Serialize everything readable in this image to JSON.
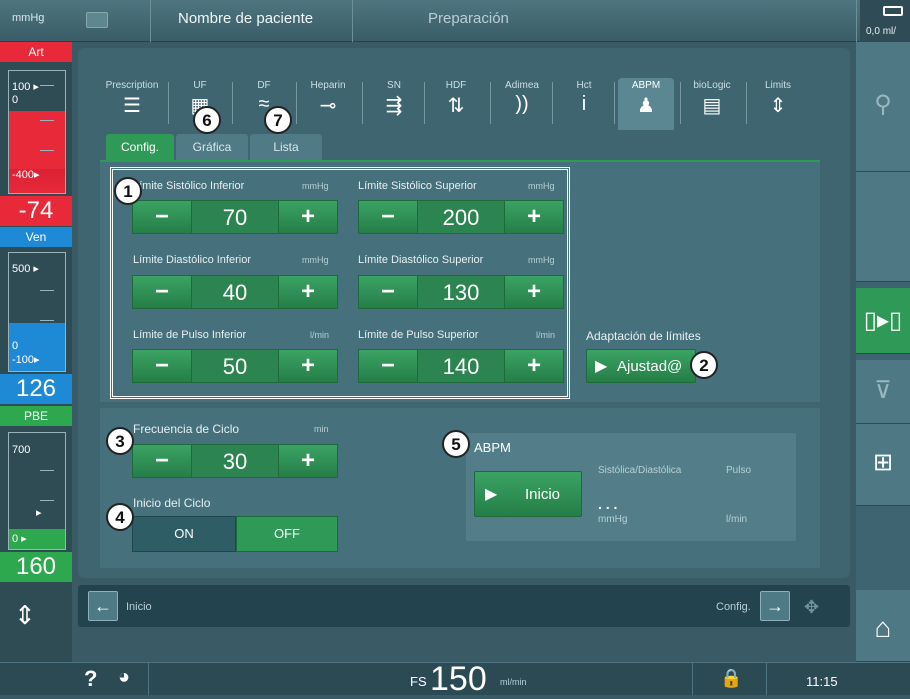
{
  "header": {
    "unit": "mmHg",
    "patient_name": "Nombre de paciente",
    "phase": "Preparación",
    "right_value": "0,0",
    "right_unit": "ml/"
  },
  "left": {
    "art": {
      "label": "Art",
      "max": "100",
      "min_top": "0",
      "min": "-400",
      "value": "-74",
      "color": "#e8293a"
    },
    "ven": {
      "label": "Ven",
      "max": "500",
      "min_top": "0",
      "min": "-100",
      "value": "126",
      "color": "#1e8ad6"
    },
    "pbe": {
      "label": "PBE",
      "max": "700",
      "min": "0",
      "value": "160",
      "color": "#2ea84f"
    }
  },
  "tabs": [
    {
      "label": "Prescription",
      "icon": "sliders-icon",
      "glyph": "☰"
    },
    {
      "label": "UF",
      "icon": "uf-icon",
      "glyph": "▦"
    },
    {
      "label": "DF",
      "icon": "df-icon",
      "glyph": "≈"
    },
    {
      "label": "Heparin",
      "icon": "syringe-icon",
      "glyph": "⊸"
    },
    {
      "label": "SN",
      "icon": "single-needle-icon",
      "glyph": "⇶"
    },
    {
      "label": "HDF",
      "icon": "hdf-icon",
      "glyph": "⇅"
    },
    {
      "label": "Adimea",
      "icon": "signal-icon",
      "glyph": "))"
    },
    {
      "label": "Hct",
      "icon": "hct-icon",
      "glyph": "i"
    },
    {
      "label": "ABPM",
      "icon": "person-icon",
      "glyph": "♟"
    },
    {
      "label": "bioLogic",
      "icon": "biologic-icon",
      "glyph": "▤"
    },
    {
      "label": "Limits",
      "icon": "limits-icon",
      "glyph": "⇕"
    }
  ],
  "subtabs": {
    "config": "Config.",
    "grafica": "Gráfica",
    "lista": "Lista"
  },
  "limits": {
    "sys_low": {
      "label": "Límite Sistólico Inferior",
      "unit": "mmHg",
      "value": "70"
    },
    "sys_high": {
      "label": "Límite Sistólico Superior",
      "unit": "mmHg",
      "value": "200"
    },
    "dia_low": {
      "label": "Límite Diastólico Inferior",
      "unit": "mmHg",
      "value": "40"
    },
    "dia_high": {
      "label": "Límite Diastólico Superior",
      "unit": "mmHg",
      "value": "130"
    },
    "pulse_low": {
      "label": "Límite de Pulso Inferior",
      "unit": "l/min",
      "value": "50"
    },
    "pulse_high": {
      "label": "Límite de Pulso Superior",
      "unit": "l/min",
      "value": "140"
    }
  },
  "stepper": {
    "minus": "−",
    "plus": "+"
  },
  "adaptation": {
    "label": "Adaptación de límites",
    "button": "Ajustad@"
  },
  "cycle": {
    "label": "Frecuencia de Ciclo",
    "unit": "min",
    "value": "30"
  },
  "start": {
    "label": "Inicio del Ciclo",
    "on": "ON",
    "off": "OFF"
  },
  "abpm": {
    "title": "ABPM",
    "button": "Inicio",
    "sys_dia": "Sistólica/Diastólica",
    "pulse": "Pulso",
    "value": ". . .",
    "unit1": "mmHg",
    "unit2": "l/min"
  },
  "callouts": [
    "1",
    "2",
    "3",
    "4",
    "5",
    "6",
    "7"
  ],
  "nav": {
    "back_label": "Inicio",
    "next_label": "Config."
  },
  "status": {
    "help": "?",
    "fs": "FS",
    "flow": "150",
    "flow_unit": "ml/min",
    "time": "11:15"
  }
}
